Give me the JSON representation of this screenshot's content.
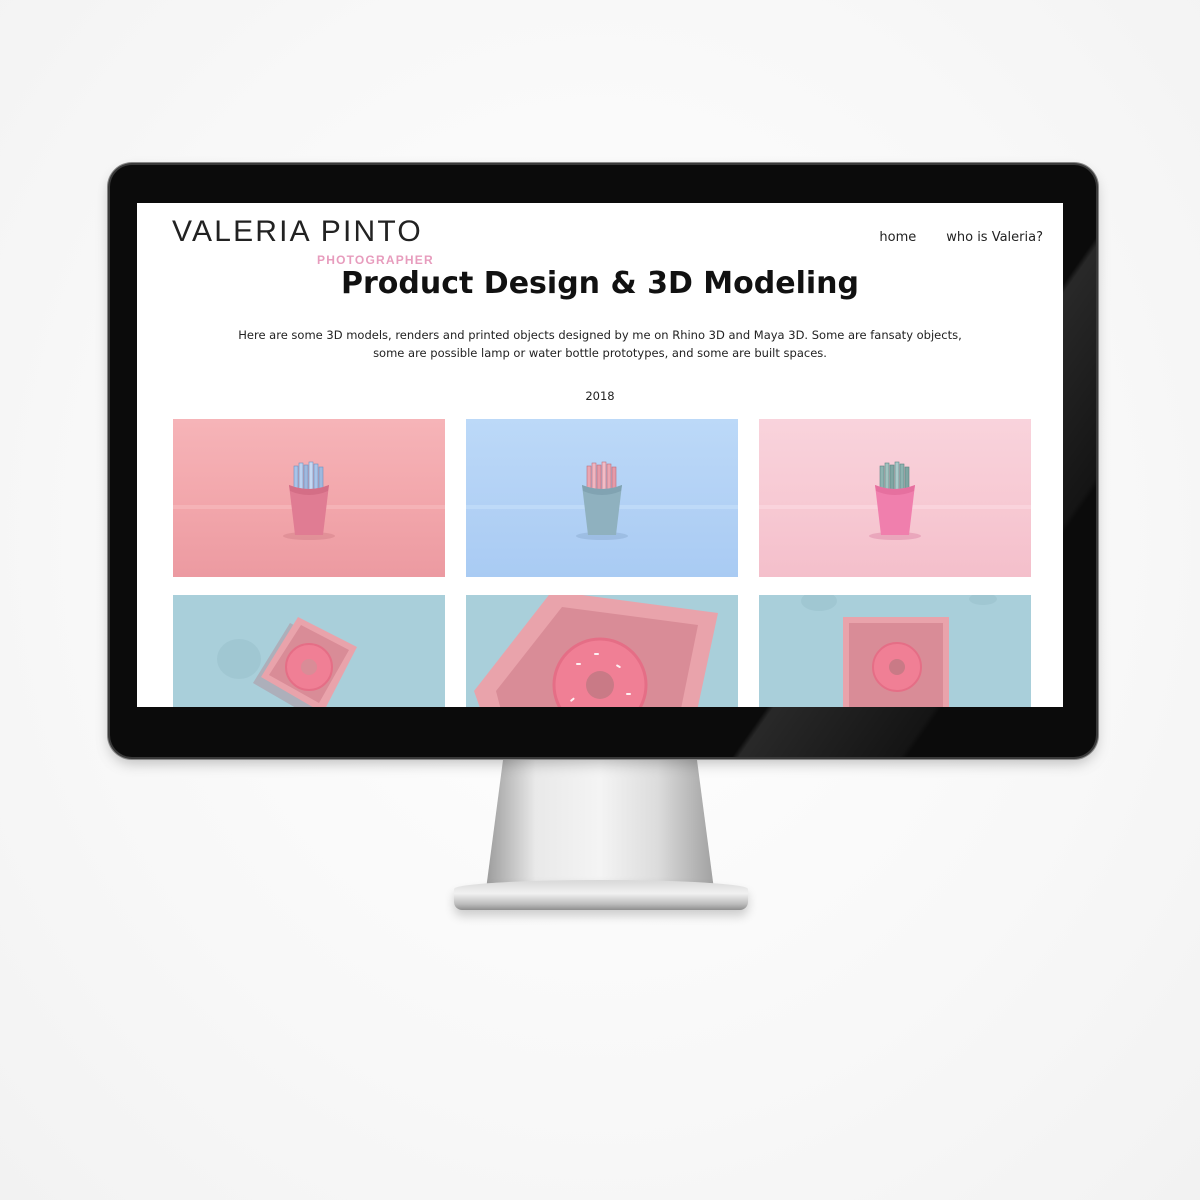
{
  "brand": {
    "name": "VALERIA PINTO",
    "subtitle": "PHOTOGRAPHER"
  },
  "nav": [
    {
      "label": "home"
    },
    {
      "label": "who is Valeria?"
    }
  ],
  "page": {
    "title": "Product Design & 3D Modeling",
    "intro": "Here are some 3D models, renders and printed objects designed by me on Rhino 3D and Maya 3D. Some are fansaty objects, some are possible lamp or water bottle prototypes, and some are built spaces.",
    "year": "2018"
  },
  "gallery": [
    {
      "subject": "fries-box",
      "background": "#f4a9ae",
      "box_color": "#e07c93",
      "fries_color": "#9fb8de"
    },
    {
      "subject": "fries-box",
      "background": "#b5d4f6",
      "box_color": "#8fb1bf",
      "fries_color": "#e59aa8"
    },
    {
      "subject": "fries-box",
      "background": "#f8ccd6",
      "box_color": "#f07fad",
      "fries_color": "#7fa6a3"
    },
    {
      "subject": "donut-box",
      "background": "#a9cfda",
      "box_color": "#e9a3ab",
      "donut_color": "#f07f95"
    },
    {
      "subject": "donut-box",
      "background": "#a9cfda",
      "box_color": "#e9a3ab",
      "donut_color": "#f07f95"
    },
    {
      "subject": "donut-box",
      "background": "#a9cfda",
      "box_color": "#e9a3ab",
      "donut_color": "#f07f95"
    }
  ]
}
